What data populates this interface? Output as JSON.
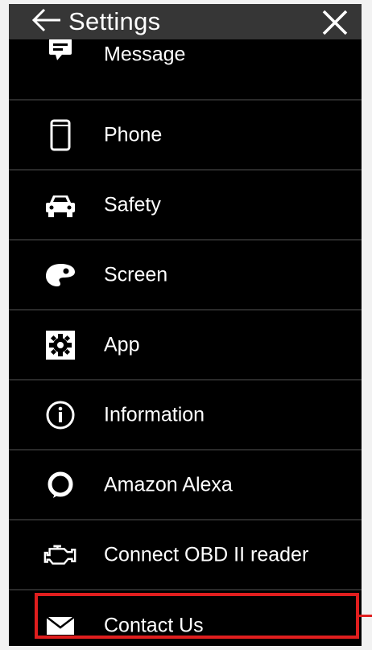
{
  "header": {
    "title": "Settings"
  },
  "menu": {
    "items": [
      {
        "label": "Message",
        "icon": "message-icon"
      },
      {
        "label": "Phone",
        "icon": "phone-icon"
      },
      {
        "label": "Safety",
        "icon": "car-icon"
      },
      {
        "label": "Screen",
        "icon": "palette-icon"
      },
      {
        "label": "App",
        "icon": "gear-icon"
      },
      {
        "label": "Information",
        "icon": "info-icon"
      },
      {
        "label": "Amazon Alexa",
        "icon": "alexa-icon"
      },
      {
        "label": "Connect OBD II reader",
        "icon": "engine-icon"
      },
      {
        "label": "Contact Us",
        "icon": "envelope-icon"
      }
    ]
  },
  "colors": {
    "background": "#000000",
    "header": "#363636",
    "highlight": "#e01e1e",
    "text": "#ffffff"
  }
}
